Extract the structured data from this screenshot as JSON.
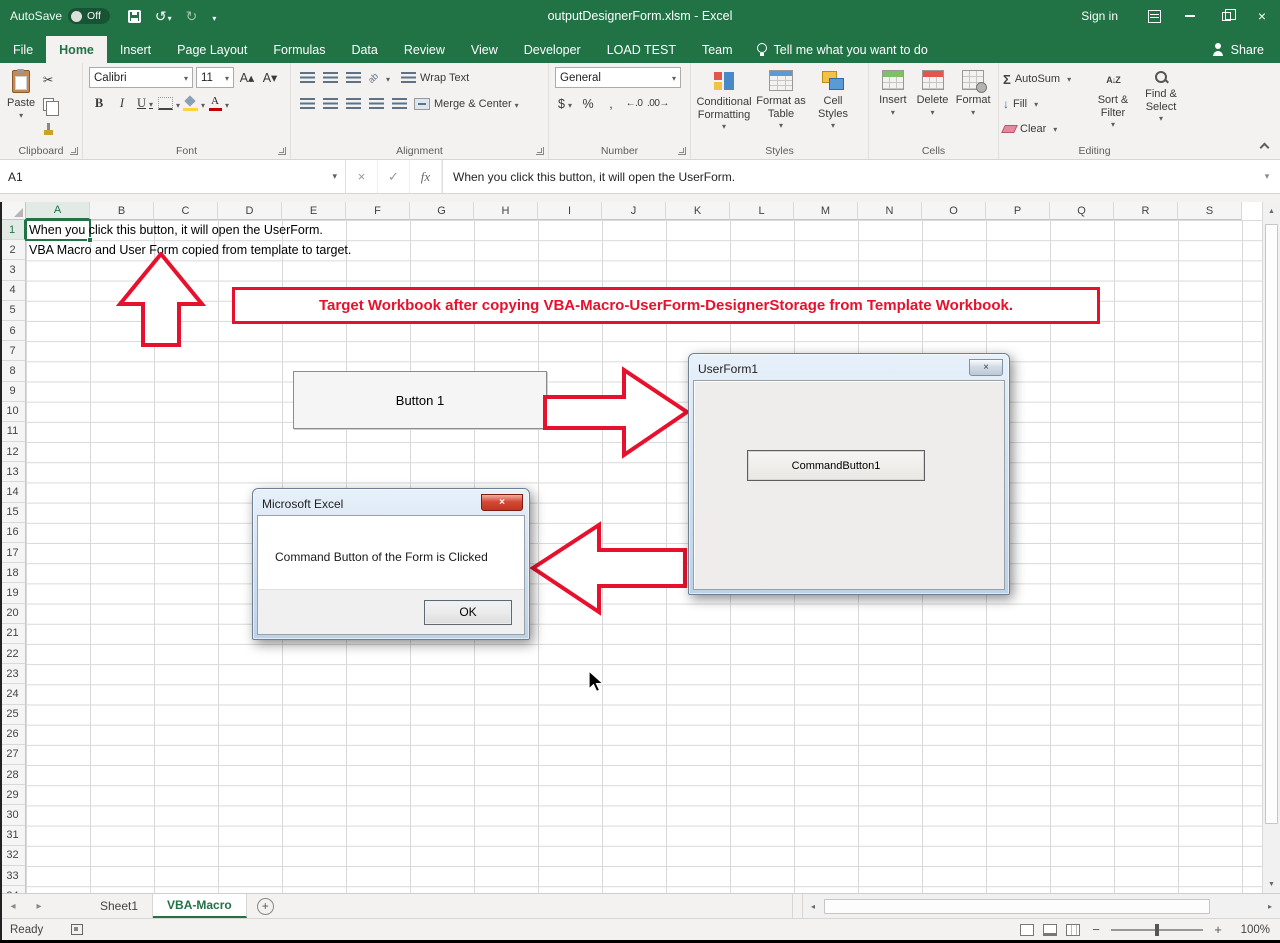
{
  "title_bar": {
    "autosave_label": "AutoSave",
    "autosave_state": "Off",
    "document_title": "outputDesignerForm.xlsm  -  Excel",
    "sign_in": "Sign in"
  },
  "ribbon_tabs": [
    {
      "label": "File",
      "active": false
    },
    {
      "label": "Home",
      "active": true
    },
    {
      "label": "Insert",
      "active": false
    },
    {
      "label": "Page Layout",
      "active": false
    },
    {
      "label": "Formulas",
      "active": false
    },
    {
      "label": "Data",
      "active": false
    },
    {
      "label": "Review",
      "active": false
    },
    {
      "label": "View",
      "active": false
    },
    {
      "label": "Developer",
      "active": false
    },
    {
      "label": "LOAD TEST",
      "active": false
    },
    {
      "label": "Team",
      "active": false
    }
  ],
  "tell_me_label": "Tell me what you want to do",
  "share_label": "Share",
  "icons": {
    "undo": "↺",
    "redo": "↻",
    "close": "×",
    "cut": "✂",
    "bold": "B",
    "italic": "I",
    "underline": "U",
    "grow_font": "A▴",
    "shrink_font": "A▾",
    "font_color_letter": "A",
    "dollar": "$",
    "percent": "%",
    "comma": ",",
    "increase_decimal": "←.0",
    "decrease_decimal": ".00→",
    "autosum": "Σ",
    "fill_arrow": "↓",
    "sort_az": "A↓Z",
    "cancel": "×",
    "enter": "✓",
    "function_fx": "fx",
    "zoom_out": "−",
    "zoom_in": "+"
  },
  "ribbon": {
    "clipboard": {
      "group_label": "Clipboard",
      "paste_label": "Paste"
    },
    "font": {
      "group_label": "Font",
      "font_name": "Calibri",
      "font_size": "11"
    },
    "alignment": {
      "group_label": "Alignment",
      "wrap_text_label": "Wrap Text",
      "merge_center_label": "Merge & Center"
    },
    "number": {
      "group_label": "Number",
      "number_format": "General"
    },
    "styles": {
      "group_label": "Styles",
      "conditional_label": "Conditional Formatting",
      "format_table_label": "Format as Table",
      "cell_styles_label": "Cell Styles"
    },
    "cells": {
      "group_label": "Cells",
      "insert_label": "Insert",
      "delete_label": "Delete",
      "format_label": "Format"
    },
    "editing": {
      "group_label": "Editing",
      "autosum_label": "AutoSum",
      "fill_label": "Fill",
      "clear_label": "Clear",
      "sort_label": "Sort & Filter",
      "find_label": "Find & Select"
    }
  },
  "formula_bar": {
    "name_box": "A1",
    "formula": "When you click this button, it will open the UserForm."
  },
  "grid": {
    "columns": [
      "A",
      "B",
      "C",
      "D",
      "E",
      "F",
      "G",
      "H",
      "I",
      "J",
      "K",
      "L",
      "M",
      "N",
      "O",
      "P",
      "Q",
      "R",
      "S"
    ],
    "row_count": 34,
    "selected_cell": "A1",
    "cell_texts": [
      {
        "row": 1,
        "text": "When you click this button, it will open the UserForm."
      },
      {
        "row": 2,
        "text": "VBA Macro and User Form copied from template to target."
      }
    ]
  },
  "annotations": {
    "banner_text": "Target Workbook after copying VBA-Macro-UserForm-DesignerStorage from Template Workbook.",
    "accent_color": "#e8112d"
  },
  "worksheet_button": {
    "label": "Button 1"
  },
  "userform": {
    "title": "UserForm1",
    "button_label": "CommandButton1"
  },
  "message_box": {
    "title": "Microsoft Excel",
    "message": "Command Button of the Form is Clicked",
    "ok_label": "OK"
  },
  "sheet_tabs": [
    {
      "label": "Sheet1",
      "active": false
    },
    {
      "label": "VBA-Macro",
      "active": true
    }
  ],
  "status_bar": {
    "ready_label": "Ready",
    "zoom_value": "100%"
  }
}
